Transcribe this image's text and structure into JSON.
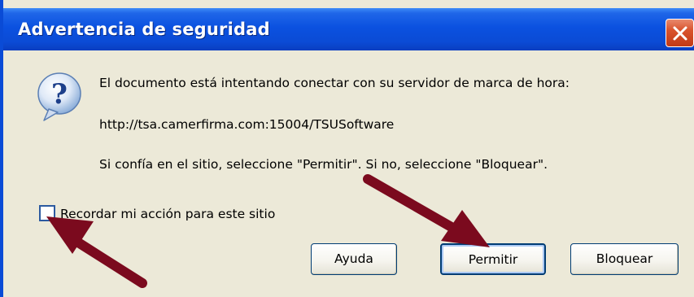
{
  "window": {
    "title": "Advertencia de seguridad",
    "close_icon": "close-x-icon"
  },
  "content": {
    "icon": "question-icon",
    "message_line1": "El documento está intentando conectar con su servidor de marca de hora:",
    "server_url": "http://tsa.camerfirma.com:15004/TSUSoftware",
    "message_line3": "Si confía en el sitio, seleccione \"Permitir\". Si no, seleccione \"Bloquear\"."
  },
  "checkbox": {
    "label": "Recordar mi acción para este sitio",
    "checked": false
  },
  "buttons": {
    "help": "Ayuda",
    "allow": "Permitir",
    "block": "Bloquear"
  },
  "colors": {
    "titlebar": "#0b4bd5",
    "dialog_bg": "#ece9d8",
    "annotation_arrow": "#7b0a1e",
    "close_button": "#d9532d"
  }
}
